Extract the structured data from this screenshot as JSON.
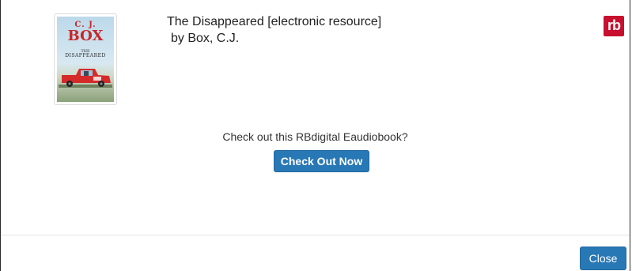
{
  "book": {
    "title": "The Disappeared [electronic resource]",
    "byline": "by Box, C.J.",
    "cover": {
      "author_line1": "C. J.",
      "author_line2": "BOX",
      "subtitle_line1": "THE",
      "subtitle_line2": "DISAPPEARED"
    }
  },
  "provider": {
    "logo_text": "rb",
    "logo_color": "#c8102e",
    "logo_icon": "rbdigital-logo-icon"
  },
  "dialog": {
    "prompt": "Check out this RBdigital Eaudiobook?",
    "checkout_label": "Check Out Now",
    "close_label": "Close"
  },
  "colors": {
    "primary_button": "#2878b5",
    "text": "#222222"
  }
}
